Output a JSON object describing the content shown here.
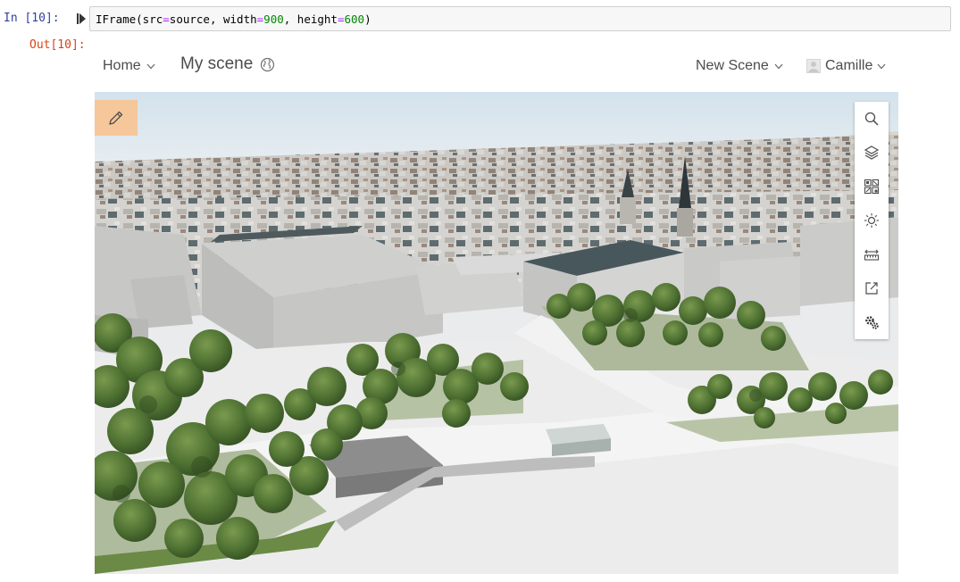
{
  "notebook": {
    "input_prompt": "In [10]:",
    "code": {
      "prefix": "IFrame(src",
      "eq1": "=",
      "src_arg": "source, width",
      "eq2": "=",
      "width_val": "900",
      "mid": ", height",
      "eq3": "=",
      "height_val": "600",
      "suffix": ")"
    },
    "output_prompt": "Out[10]:"
  },
  "scene_viewer": {
    "home_label": "Home",
    "title": "My scene",
    "new_scene_label": "New Scene",
    "user_name": "Camille",
    "toolbar": [
      {
        "name": "search-tool",
        "icon": "search-icon"
      },
      {
        "name": "layers-tool",
        "icon": "layers-icon"
      },
      {
        "name": "basemap-tool",
        "icon": "basemap-gallery-icon"
      },
      {
        "name": "daylight-tool",
        "icon": "sun-icon"
      },
      {
        "name": "measure-tool",
        "icon": "measure-icon"
      },
      {
        "name": "share-tool",
        "icon": "share-icon"
      },
      {
        "name": "settings-tool",
        "icon": "gears-icon"
      }
    ],
    "edit_button_icon": "pencil-icon",
    "colors": {
      "edit_button_bg": "#f5c79a",
      "tree_green": "#4e7a32",
      "sky": "#dfe8ee"
    }
  }
}
